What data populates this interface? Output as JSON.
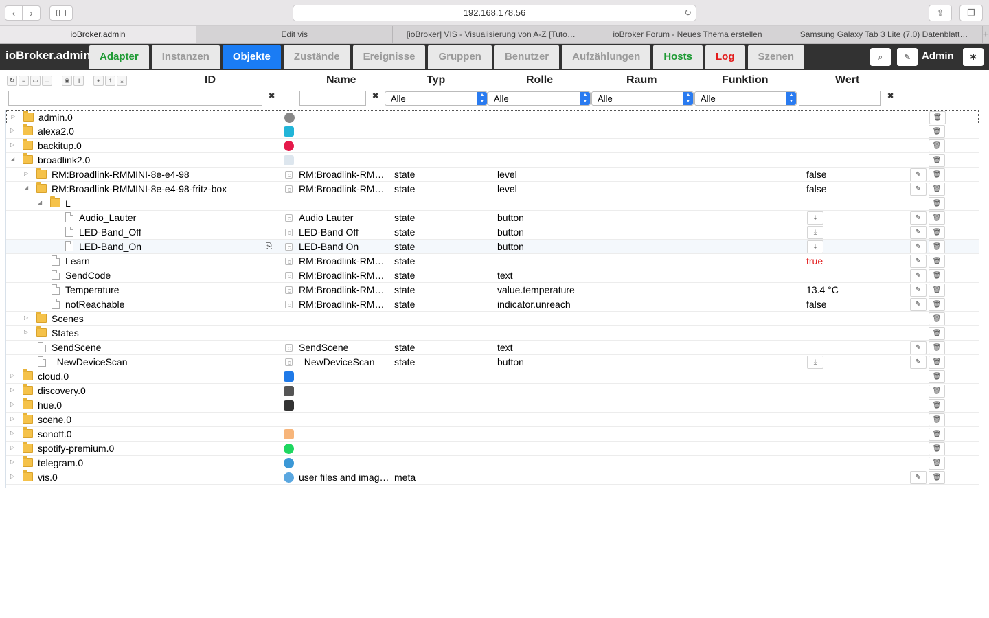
{
  "browser": {
    "url": "192.168.178.56",
    "tabs": [
      "ioBroker.admin",
      "Edit vis",
      "[ioBroker] VIS - Visualisierung von A-Z [Tuto…",
      "ioBroker Forum - Neues Thema erstellen",
      "Samsung Galaxy Tab 3 Lite (7.0) Datenblatt…"
    ],
    "new_tab": "+"
  },
  "app": {
    "brand": "ioBroker.admin",
    "nav": [
      "Adapter",
      "Instanzen",
      "Objekte",
      "Zustände",
      "Ereignisse",
      "Gruppen",
      "Benutzer",
      "Aufzählungen",
      "Hosts",
      "Log",
      "Szenen"
    ],
    "active_nav": "Objekte",
    "user": "Admin",
    "colors": {
      "active": "#1a7cf4",
      "green": "#1e9a34",
      "red": "#e31b1b",
      "header": "#323232"
    }
  },
  "columns": {
    "id": "ID",
    "name": "Name",
    "typ": "Typ",
    "rolle": "Rolle",
    "raum": "Raum",
    "funktion": "Funktion",
    "wert": "Wert"
  },
  "filters": {
    "typ": "Alle",
    "rolle": "Alle",
    "raum": "Alle",
    "funktion": "Alle",
    "clear": "✖"
  },
  "rows": [
    {
      "label": "admin.0",
      "name": "",
      "typ": "",
      "rolle": "",
      "wert": ""
    },
    {
      "label": "alexa2.0",
      "name": "",
      "typ": "",
      "rolle": "",
      "wert": ""
    },
    {
      "label": "backitup.0",
      "name": "",
      "typ": "",
      "rolle": "",
      "wert": ""
    },
    {
      "label": "broadlink2.0",
      "name": "",
      "typ": "",
      "rolle": "",
      "wert": ""
    },
    {
      "label": "RM:Broadlink-RMMINI-8e-e4-98",
      "name": "RM:Broadlink-RMM…",
      "typ": "state",
      "rolle": "level",
      "wert": "false"
    },
    {
      "label": "RM:Broadlink-RMMINI-8e-e4-98-fritz-box",
      "name": "RM:Broadlink-RMM…",
      "typ": "state",
      "rolle": "level",
      "wert": "false"
    },
    {
      "label": "L",
      "name": "",
      "typ": "",
      "rolle": "",
      "wert": ""
    },
    {
      "label": "Audio_Lauter",
      "name": "Audio Lauter",
      "typ": "state",
      "rolle": "button",
      "wert": ""
    },
    {
      "label": "LED-Band_Off",
      "name": "LED-Band Off",
      "typ": "state",
      "rolle": "button",
      "wert": ""
    },
    {
      "label": "LED-Band_On",
      "name": "LED-Band On",
      "typ": "state",
      "rolle": "button",
      "wert": ""
    },
    {
      "label": "Learn",
      "name": "RM:Broadlink-RMM…",
      "typ": "state",
      "rolle": "",
      "wert": "true"
    },
    {
      "label": "SendCode",
      "name": "RM:Broadlink-RMM…",
      "typ": "state",
      "rolle": "text",
      "wert": ""
    },
    {
      "label": "Temperature",
      "name": "RM:Broadlink-RMM…",
      "typ": "state",
      "rolle": "value.temperature",
      "wert": "13.4 °C"
    },
    {
      "label": "notReachable",
      "name": "RM:Broadlink-RMM…",
      "typ": "state",
      "rolle": "indicator.unreach",
      "wert": "false"
    },
    {
      "label": "Scenes",
      "name": "",
      "typ": "",
      "rolle": "",
      "wert": ""
    },
    {
      "label": "States",
      "name": "",
      "typ": "",
      "rolle": "",
      "wert": ""
    },
    {
      "label": "SendScene",
      "name": "SendScene",
      "typ": "state",
      "rolle": "text",
      "wert": ""
    },
    {
      "label": "_NewDeviceScan",
      "name": "_NewDeviceScan",
      "typ": "state",
      "rolle": "button",
      "wert": ""
    },
    {
      "label": "cloud.0",
      "name": "",
      "typ": "",
      "rolle": "",
      "wert": ""
    },
    {
      "label": "discovery.0",
      "name": "",
      "typ": "",
      "rolle": "",
      "wert": ""
    },
    {
      "label": "hue.0",
      "name": "",
      "typ": "",
      "rolle": "",
      "wert": ""
    },
    {
      "label": "scene.0",
      "name": "",
      "typ": "",
      "rolle": "",
      "wert": ""
    },
    {
      "label": "sonoff.0",
      "name": "",
      "typ": "",
      "rolle": "",
      "wert": ""
    },
    {
      "label": "spotify-premium.0",
      "name": "",
      "typ": "",
      "rolle": "",
      "wert": ""
    },
    {
      "label": "telegram.0",
      "name": "",
      "typ": "",
      "rolle": "",
      "wert": ""
    },
    {
      "label": "vis.0",
      "name": "user files and imag…",
      "typ": "meta",
      "rolle": "",
      "wert": ""
    }
  ]
}
